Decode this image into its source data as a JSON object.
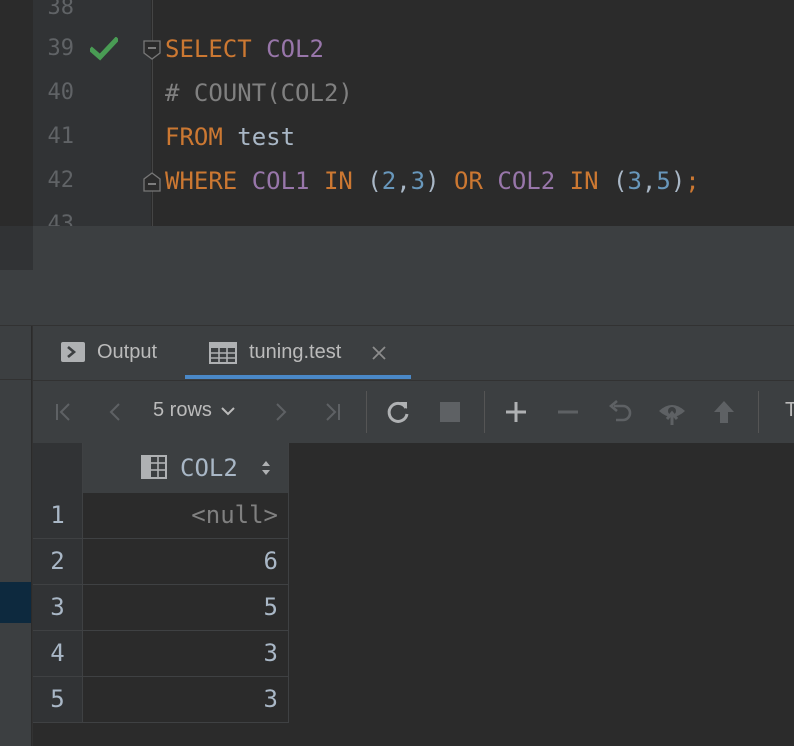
{
  "editor": {
    "lines": [
      {
        "num": "38"
      },
      {
        "num": "39",
        "has_check": true,
        "fold": "start",
        "tokens": [
          {
            "t": "SELECT",
            "c": "kw"
          },
          {
            "t": " ",
            "c": "plain"
          },
          {
            "t": "COL2",
            "c": "col"
          }
        ]
      },
      {
        "num": "40",
        "tokens": [
          {
            "t": "# COUNT(COL2)",
            "c": "cmt"
          }
        ]
      },
      {
        "num": "41",
        "tokens": [
          {
            "t": "FROM",
            "c": "kw"
          },
          {
            "t": " test",
            "c": "plain"
          }
        ]
      },
      {
        "num": "42",
        "fold": "end",
        "tokens": [
          {
            "t": "WHERE",
            "c": "kw"
          },
          {
            "t": " ",
            "c": "plain"
          },
          {
            "t": "COL1",
            "c": "col"
          },
          {
            "t": " ",
            "c": "plain"
          },
          {
            "t": "IN",
            "c": "kw"
          },
          {
            "t": " (",
            "c": "plain"
          },
          {
            "t": "2",
            "c": "num"
          },
          {
            "t": ",",
            "c": "plain"
          },
          {
            "t": "3",
            "c": "num"
          },
          {
            "t": ") ",
            "c": "plain"
          },
          {
            "t": "OR",
            "c": "kw"
          },
          {
            "t": " ",
            "c": "plain"
          },
          {
            "t": "COL2",
            "c": "col"
          },
          {
            "t": " ",
            "c": "plain"
          },
          {
            "t": "IN",
            "c": "kw"
          },
          {
            "t": " (",
            "c": "plain"
          },
          {
            "t": "3",
            "c": "num"
          },
          {
            "t": ",",
            "c": "plain"
          },
          {
            "t": "5",
            "c": "num"
          },
          {
            "t": ")",
            "c": "plain"
          },
          {
            "t": ";",
            "c": "kw"
          }
        ]
      },
      {
        "num": "43"
      }
    ]
  },
  "tabs": [
    {
      "label": "Output",
      "icon": "console-icon"
    },
    {
      "label": "tuning.test",
      "icon": "table-icon",
      "active": true,
      "closable": true
    }
  ],
  "toolbar": {
    "rows_label": "5 rows",
    "buttons": [
      "first-page-icon",
      "previous-page-icon",
      "next-page-icon",
      "last-page-icon",
      "reload-icon",
      "stop-icon",
      "add-row-icon",
      "delete-row-icon",
      "revert-icon",
      "view-query-icon",
      "submit-icon"
    ],
    "overflow_text": "T"
  },
  "grid": {
    "column": "COL2",
    "rows": [
      {
        "n": "1",
        "value": "<null>"
      },
      {
        "n": "2",
        "value": "6"
      },
      {
        "n": "3",
        "value": "5"
      },
      {
        "n": "4",
        "value": "3"
      },
      {
        "n": "5",
        "value": "3"
      }
    ]
  },
  "colors": {
    "keyword": "#cc7832",
    "column": "#9876aa",
    "number": "#6897bb",
    "comment": "#808080",
    "success": "#499c54",
    "accent": "#4a88c7"
  }
}
